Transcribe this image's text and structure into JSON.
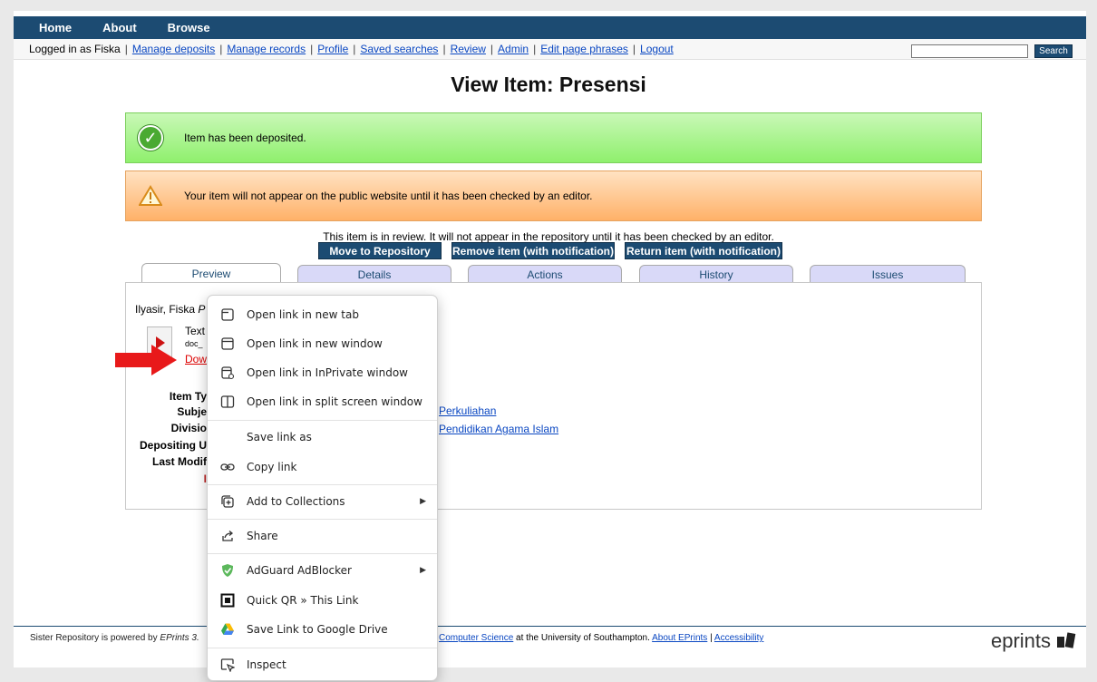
{
  "nav": {
    "items": [
      "Home",
      "About",
      "Browse"
    ]
  },
  "userbar": {
    "logged_in": "Logged in as Fiska",
    "links": [
      "Manage deposits",
      "Manage records",
      "Profile",
      "Saved searches",
      "Review",
      "Admin",
      "Edit page phrases",
      "Logout"
    ]
  },
  "search": {
    "button": "Search",
    "value": ""
  },
  "page_title": "View Item: Presensi",
  "messages": {
    "deposited": "Item has been deposited.",
    "warning": "Your item will not appear on the public website until it has been checked by an editor."
  },
  "review_text": "This item is in review. It will not appear in the repository until it has been checked by an editor.",
  "actions": [
    "Move to Repository",
    "Remove item (with notification)",
    "Return item (with notification)"
  ],
  "tabs": [
    "Preview",
    "Details",
    "Actions",
    "History",
    "Issues"
  ],
  "preview": {
    "author": "Ilyasir, Fiska",
    "author_italic": "P",
    "doc_type": "Text",
    "doc_file": "doc_",
    "download": "Dow",
    "labels": [
      "Item Ty",
      "Subje",
      "Divisio",
      "Depositing U",
      "Last Modif"
    ],
    "last_mark": "I",
    "subject_link": "Perkuliahan",
    "division_link": "Pendidikan Agama Islam"
  },
  "footer": {
    "left": "Sister Repository is powered by ",
    "left_italic": "EPrints 3.",
    "right_link1": "Computer Science",
    "right_mid": " at the University of Southampton. ",
    "right_link2": "About EPrints",
    "right_sep": " | ",
    "right_link3": "Accessibility",
    "logo": "eprints"
  },
  "context_menu": {
    "items": [
      {
        "label": "Open link in new tab",
        "icon": "new-tab-icon"
      },
      {
        "label": "Open link in new window",
        "icon": "new-window-icon"
      },
      {
        "label": "Open link in InPrivate window",
        "icon": "inprivate-icon"
      },
      {
        "label": "Open link in split screen window",
        "icon": "split-screen-icon"
      },
      {
        "label": "Save link as",
        "icon": ""
      },
      {
        "label": "Copy link",
        "icon": "link-icon"
      },
      {
        "label": "Add to Collections",
        "icon": "collections-icon",
        "submenu": true
      },
      {
        "label": "Share",
        "icon": "share-icon"
      },
      {
        "label": "AdGuard AdBlocker",
        "icon": "adguard-icon",
        "submenu": true
      },
      {
        "label": "Quick QR » This Link",
        "icon": "qr-icon"
      },
      {
        "label": "Save Link to Google Drive",
        "icon": "google-drive-icon"
      },
      {
        "label": "Inspect",
        "icon": "inspect-icon"
      }
    ]
  },
  "colors": {
    "accent": "#1c4b72",
    "arrow": "#e8191a",
    "link": "#0a47c2"
  }
}
